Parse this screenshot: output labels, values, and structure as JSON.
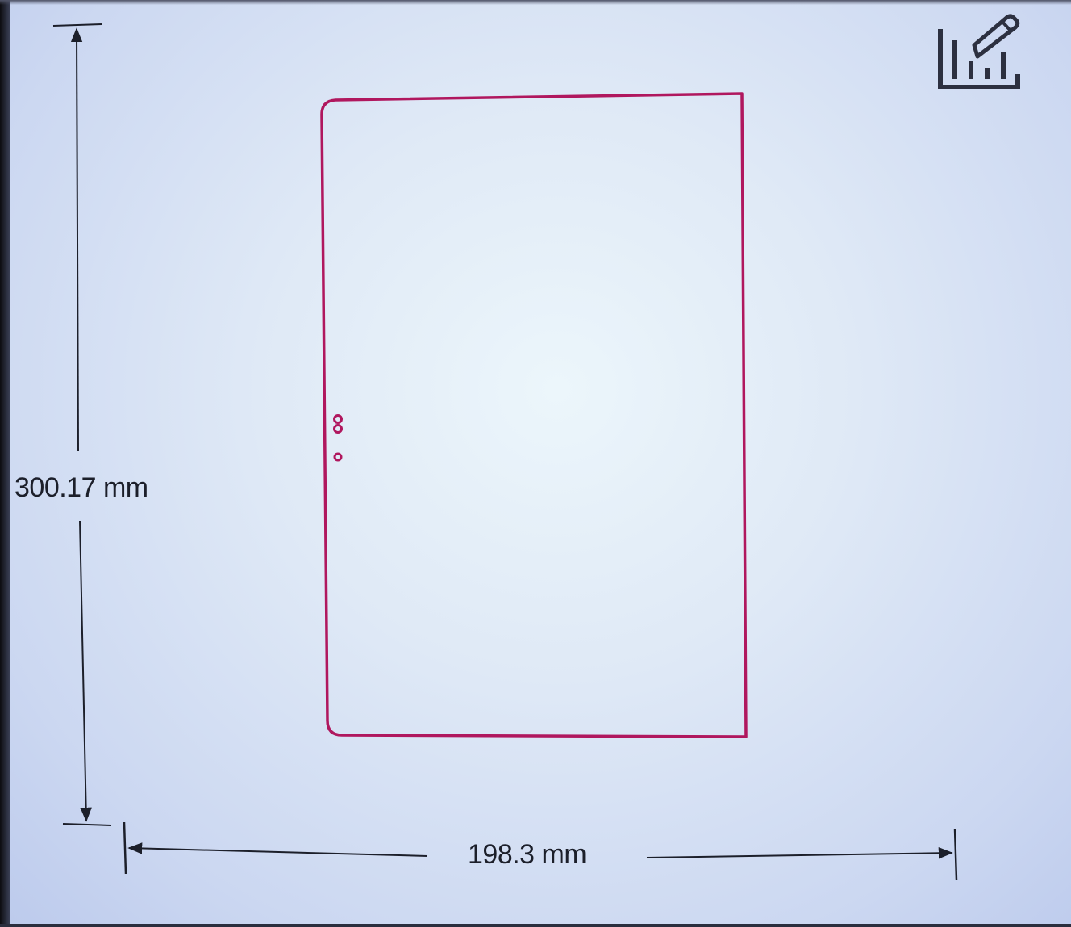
{
  "outline": {
    "height_label": "300.17 mm",
    "width_label": "198.3 mm",
    "line_color": "#b0175e",
    "markers": [
      {
        "type": "double-circle"
      },
      {
        "type": "single-circle"
      }
    ]
  },
  "toolbar": {
    "edit_icon": "chart-edit-icon"
  },
  "colors": {
    "background": "#dfe9f6",
    "dimension_lines": "#1c1f2a",
    "shape_outline": "#b0175e"
  }
}
